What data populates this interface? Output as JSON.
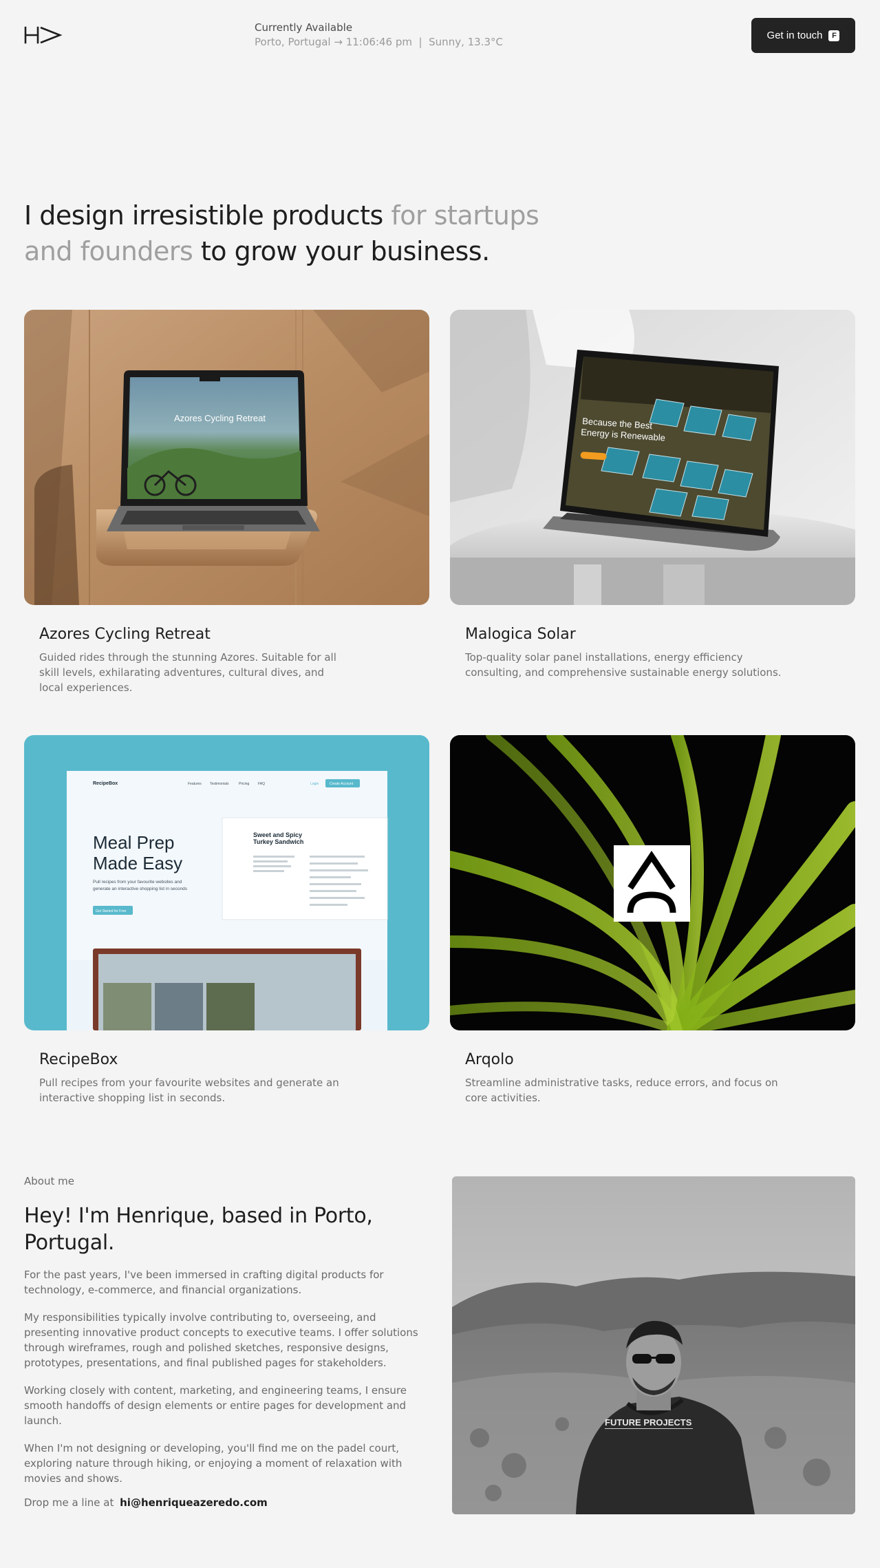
{
  "header": {
    "logo_icon": "hd-monogram-logo-icon",
    "status_title": "Currently Available",
    "location": "Porto, Portugal",
    "arrow": "→",
    "time": "11:06:46 pm",
    "separator": "|",
    "weather": "Sunny, 13.3°C",
    "cta_label": "Get in touch",
    "cta_shortcut": "F"
  },
  "hero": {
    "part1": "I design irresistible products",
    "part2": "for startups and founders",
    "part3": "to grow your business."
  },
  "projects": [
    {
      "title": "Azores Cycling Retreat",
      "description": "Guided rides through the stunning Azores. Suitable for all skill levels, exhilarating adventures, cultural dives, and local experiences.",
      "mock_text": "Azores Cycling Retreat"
    },
    {
      "title": "Malogica Solar",
      "description": "Top-quality solar panel installations, energy efficiency consulting, and comprehensive sustainable energy solutions.",
      "mock_text_1": "Because the Best",
      "mock_text_2": "Energy is Renewable"
    },
    {
      "title": "RecipeBox",
      "description": "Pull recipes from your favourite websites and generate an interactive shopping list in seconds.",
      "mock_brand": "RecipeBox",
      "mock_nav": [
        "Features",
        "Testimonials",
        "Pricing",
        "FAQ"
      ],
      "mock_login": "Login",
      "mock_signup": "Create Account",
      "mock_headline_1": "Meal Prep",
      "mock_headline_2": "Made Easy",
      "mock_sub_1": "Pull recipes from your favourite websites and",
      "mock_sub_2": "generate an interactive shopping list in seconds",
      "mock_button": "Get Started for Free",
      "mock_recipe_1": "Sweet and Spicy",
      "mock_recipe_2": "Turkey Sandwich"
    },
    {
      "title": "Arqolo",
      "description": "Streamline administrative tasks, reduce errors, and focus on core activities."
    }
  ],
  "about": {
    "label": "About me",
    "heading": "Hey! I'm Henrique, based in Porto, Portugal.",
    "paragraphs": [
      "For the past years, I've been immersed in crafting digital products for technology, e-commerce, and financial organizations.",
      "My responsibilities typically involve contributing to, overseeing, and presenting innovative product concepts to executive teams. I offer solutions through wireframes, rough and polished sketches, responsive designs, prototypes, presentations, and final published pages for stakeholders.",
      "Working closely with content, marketing, and engineering teams, I ensure smooth handoffs of design elements or entire pages for development and launch.",
      "When I'm not designing or developing, you'll find me on the padel court, exploring nature through hiking, or enjoying a moment of relaxation with movies and shows."
    ],
    "drop_label": "Drop me a line at",
    "email": "hi@henriqueazeredo.com",
    "hoodie_text": "FUTURE PROJECTS"
  },
  "colors": {
    "background": "#f4f4f4",
    "text": "#1e1e1e",
    "muted": "#9f9f9f",
    "cta_bg": "#232323",
    "recipebox_teal": "#58b9cc",
    "arqolo_green": "#9acd1a"
  }
}
